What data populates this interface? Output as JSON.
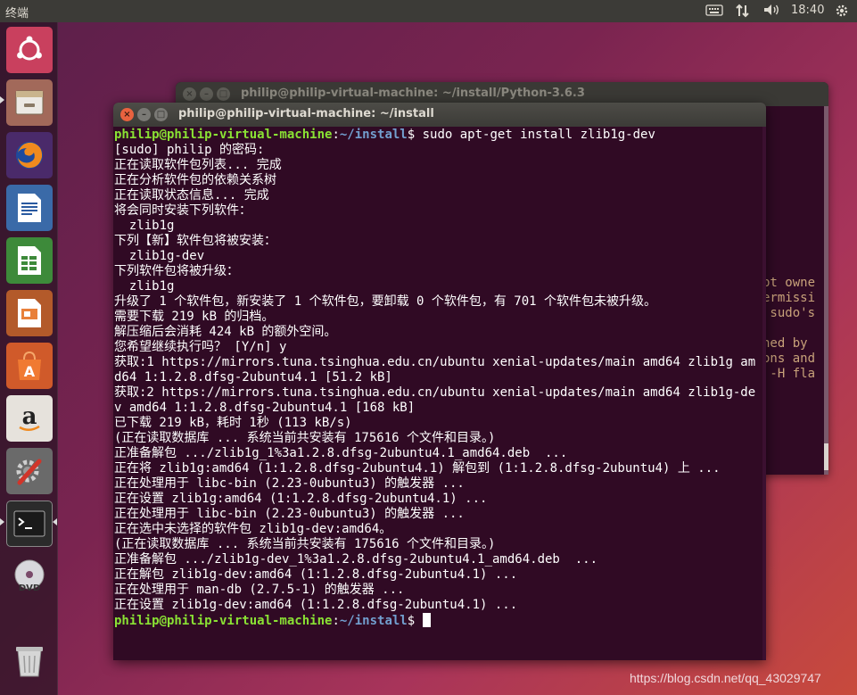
{
  "top_panel": {
    "app_title": "终端",
    "keyboard_icon": "keyboard-icon",
    "network_icon": "network-arrows-icon",
    "volume_icon": "volume-icon",
    "clock": "18:40",
    "settings_icon": "gear-icon"
  },
  "launcher": {
    "items": [
      {
        "name": "ubuntu-dash",
        "icon": "ubuntu-logo-icon"
      },
      {
        "name": "files",
        "icon": "file-cabinet-icon"
      },
      {
        "name": "firefox",
        "icon": "firefox-icon"
      },
      {
        "name": "libreoffice-writer",
        "icon": "writer-icon"
      },
      {
        "name": "libreoffice-calc",
        "icon": "calc-icon"
      },
      {
        "name": "libreoffice-impress",
        "icon": "impress-icon"
      },
      {
        "name": "software-center",
        "icon": "shopping-bag-icon"
      },
      {
        "name": "amazon",
        "icon": "amazon-icon"
      },
      {
        "name": "system-settings",
        "icon": "wrench-gear-icon"
      },
      {
        "name": "terminal",
        "icon": "terminal-icon"
      },
      {
        "name": "dvd",
        "icon": "dvd-icon"
      },
      {
        "name": "trash",
        "icon": "trash-icon"
      }
    ]
  },
  "back_window": {
    "title": "philip@philip-virtual-machine: ~/install/Python-3.6.3",
    "visible_text": "pt owne\nermissi\n sudo's\n\nhed by\nons and\n -H fla"
  },
  "front_window": {
    "title": "philip@philip-virtual-machine: ~/install",
    "prompt_user": "philip@philip-virtual-machine",
    "prompt_path": "~/install",
    "first_command": " sudo apt-get install zlib1g-dev",
    "output": "[sudo] philip 的密码:\n正在读取软件包列表... 完成\n正在分析软件包的依赖关系树\n正在读取状态信息... 完成\n将会同时安装下列软件：\n  zlib1g\n下列【新】软件包将被安装：\n  zlib1g-dev\n下列软件包将被升级：\n  zlib1g\n升级了 1 个软件包，新安装了 1 个软件包，要卸载 0 个软件包，有 701 个软件包未被升级。\n需要下载 219 kB 的归档。\n解压缩后会消耗 424 kB 的额外空间。\n您希望继续执行吗？ [Y/n] y\n获取:1 https://mirrors.tuna.tsinghua.edu.cn/ubuntu xenial-updates/main amd64 zlib1g amd64 1:1.2.8.dfsg-2ubuntu4.1 [51.2 kB]\n获取:2 https://mirrors.tuna.tsinghua.edu.cn/ubuntu xenial-updates/main amd64 zlib1g-dev amd64 1:1.2.8.dfsg-2ubuntu4.1 [168 kB]\n已下载 219 kB，耗时 1秒 (113 kB/s)\n(正在读取数据库 ... 系统当前共安装有 175616 个文件和目录。)\n正准备解包 .../zlib1g_1%3a1.2.8.dfsg-2ubuntu4.1_amd64.deb  ...\n正在将 zlib1g:amd64 (1:1.2.8.dfsg-2ubuntu4.1) 解包到 (1:1.2.8.dfsg-2ubuntu4) 上 ...\n正在处理用于 libc-bin (2.23-0ubuntu3) 的触发器 ...\n正在设置 zlib1g:amd64 (1:1.2.8.dfsg-2ubuntu4.1) ...\n正在处理用于 libc-bin (2.23-0ubuntu3) 的触发器 ...\n正在选中未选择的软件包 zlib1g-dev:amd64。\n(正在读取数据库 ... 系统当前共安装有 175616 个文件和目录。)\n正准备解包 .../zlib1g-dev_1%3a1.2.8.dfsg-2ubuntu4.1_amd64.deb  ...\n正在解包 zlib1g-dev:amd64 (1:1.2.8.dfsg-2ubuntu4.1) ...\n正在处理用于 man-db (2.7.5-1) 的触发器 ...\n正在设置 zlib1g-dev:amd64 (1:1.2.8.dfsg-2ubuntu4.1) ...",
    "last_prompt_suffix": "$ "
  },
  "watermark": "https://blog.csdn.net/qq_43029747"
}
